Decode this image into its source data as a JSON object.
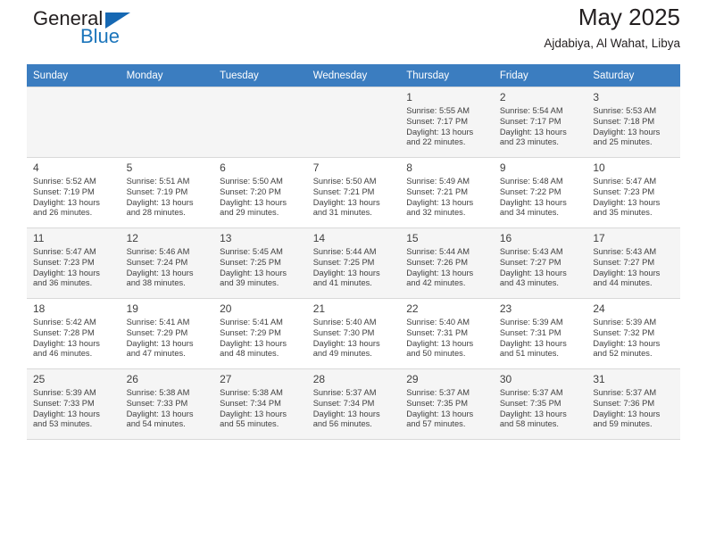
{
  "brand": {
    "name_part1": "General",
    "name_part2": "Blue",
    "triangle_color": "#1668b3",
    "blue_color": "#1b75bb"
  },
  "header": {
    "title": "May 2025",
    "subtitle": "Ajdabiya, Al Wahat, Libya"
  },
  "calendar": {
    "header_bg": "#3b7dc0",
    "weekday_headers": [
      "Sunday",
      "Monday",
      "Tuesday",
      "Wednesday",
      "Thursday",
      "Friday",
      "Saturday"
    ],
    "weeks": [
      [
        {
          "day": "",
          "sunrise": "",
          "sunset": "",
          "daylight1": "",
          "daylight2": ""
        },
        {
          "day": "",
          "sunrise": "",
          "sunset": "",
          "daylight1": "",
          "daylight2": ""
        },
        {
          "day": "",
          "sunrise": "",
          "sunset": "",
          "daylight1": "",
          "daylight2": ""
        },
        {
          "day": "",
          "sunrise": "",
          "sunset": "",
          "daylight1": "",
          "daylight2": ""
        },
        {
          "day": "1",
          "sunrise": "Sunrise: 5:55 AM",
          "sunset": "Sunset: 7:17 PM",
          "daylight1": "Daylight: 13 hours",
          "daylight2": "and 22 minutes."
        },
        {
          "day": "2",
          "sunrise": "Sunrise: 5:54 AM",
          "sunset": "Sunset: 7:17 PM",
          "daylight1": "Daylight: 13 hours",
          "daylight2": "and 23 minutes."
        },
        {
          "day": "3",
          "sunrise": "Sunrise: 5:53 AM",
          "sunset": "Sunset: 7:18 PM",
          "daylight1": "Daylight: 13 hours",
          "daylight2": "and 25 minutes."
        }
      ],
      [
        {
          "day": "4",
          "sunrise": "Sunrise: 5:52 AM",
          "sunset": "Sunset: 7:19 PM",
          "daylight1": "Daylight: 13 hours",
          "daylight2": "and 26 minutes."
        },
        {
          "day": "5",
          "sunrise": "Sunrise: 5:51 AM",
          "sunset": "Sunset: 7:19 PM",
          "daylight1": "Daylight: 13 hours",
          "daylight2": "and 28 minutes."
        },
        {
          "day": "6",
          "sunrise": "Sunrise: 5:50 AM",
          "sunset": "Sunset: 7:20 PM",
          "daylight1": "Daylight: 13 hours",
          "daylight2": "and 29 minutes."
        },
        {
          "day": "7",
          "sunrise": "Sunrise: 5:50 AM",
          "sunset": "Sunset: 7:21 PM",
          "daylight1": "Daylight: 13 hours",
          "daylight2": "and 31 minutes."
        },
        {
          "day": "8",
          "sunrise": "Sunrise: 5:49 AM",
          "sunset": "Sunset: 7:21 PM",
          "daylight1": "Daylight: 13 hours",
          "daylight2": "and 32 minutes."
        },
        {
          "day": "9",
          "sunrise": "Sunrise: 5:48 AM",
          "sunset": "Sunset: 7:22 PM",
          "daylight1": "Daylight: 13 hours",
          "daylight2": "and 34 minutes."
        },
        {
          "day": "10",
          "sunrise": "Sunrise: 5:47 AM",
          "sunset": "Sunset: 7:23 PM",
          "daylight1": "Daylight: 13 hours",
          "daylight2": "and 35 minutes."
        }
      ],
      [
        {
          "day": "11",
          "sunrise": "Sunrise: 5:47 AM",
          "sunset": "Sunset: 7:23 PM",
          "daylight1": "Daylight: 13 hours",
          "daylight2": "and 36 minutes."
        },
        {
          "day": "12",
          "sunrise": "Sunrise: 5:46 AM",
          "sunset": "Sunset: 7:24 PM",
          "daylight1": "Daylight: 13 hours",
          "daylight2": "and 38 minutes."
        },
        {
          "day": "13",
          "sunrise": "Sunrise: 5:45 AM",
          "sunset": "Sunset: 7:25 PM",
          "daylight1": "Daylight: 13 hours",
          "daylight2": "and 39 minutes."
        },
        {
          "day": "14",
          "sunrise": "Sunrise: 5:44 AM",
          "sunset": "Sunset: 7:25 PM",
          "daylight1": "Daylight: 13 hours",
          "daylight2": "and 41 minutes."
        },
        {
          "day": "15",
          "sunrise": "Sunrise: 5:44 AM",
          "sunset": "Sunset: 7:26 PM",
          "daylight1": "Daylight: 13 hours",
          "daylight2": "and 42 minutes."
        },
        {
          "day": "16",
          "sunrise": "Sunrise: 5:43 AM",
          "sunset": "Sunset: 7:27 PM",
          "daylight1": "Daylight: 13 hours",
          "daylight2": "and 43 minutes."
        },
        {
          "day": "17",
          "sunrise": "Sunrise: 5:43 AM",
          "sunset": "Sunset: 7:27 PM",
          "daylight1": "Daylight: 13 hours",
          "daylight2": "and 44 minutes."
        }
      ],
      [
        {
          "day": "18",
          "sunrise": "Sunrise: 5:42 AM",
          "sunset": "Sunset: 7:28 PM",
          "daylight1": "Daylight: 13 hours",
          "daylight2": "and 46 minutes."
        },
        {
          "day": "19",
          "sunrise": "Sunrise: 5:41 AM",
          "sunset": "Sunset: 7:29 PM",
          "daylight1": "Daylight: 13 hours",
          "daylight2": "and 47 minutes."
        },
        {
          "day": "20",
          "sunrise": "Sunrise: 5:41 AM",
          "sunset": "Sunset: 7:29 PM",
          "daylight1": "Daylight: 13 hours",
          "daylight2": "and 48 minutes."
        },
        {
          "day": "21",
          "sunrise": "Sunrise: 5:40 AM",
          "sunset": "Sunset: 7:30 PM",
          "daylight1": "Daylight: 13 hours",
          "daylight2": "and 49 minutes."
        },
        {
          "day": "22",
          "sunrise": "Sunrise: 5:40 AM",
          "sunset": "Sunset: 7:31 PM",
          "daylight1": "Daylight: 13 hours",
          "daylight2": "and 50 minutes."
        },
        {
          "day": "23",
          "sunrise": "Sunrise: 5:39 AM",
          "sunset": "Sunset: 7:31 PM",
          "daylight1": "Daylight: 13 hours",
          "daylight2": "and 51 minutes."
        },
        {
          "day": "24",
          "sunrise": "Sunrise: 5:39 AM",
          "sunset": "Sunset: 7:32 PM",
          "daylight1": "Daylight: 13 hours",
          "daylight2": "and 52 minutes."
        }
      ],
      [
        {
          "day": "25",
          "sunrise": "Sunrise: 5:39 AM",
          "sunset": "Sunset: 7:33 PM",
          "daylight1": "Daylight: 13 hours",
          "daylight2": "and 53 minutes."
        },
        {
          "day": "26",
          "sunrise": "Sunrise: 5:38 AM",
          "sunset": "Sunset: 7:33 PM",
          "daylight1": "Daylight: 13 hours",
          "daylight2": "and 54 minutes."
        },
        {
          "day": "27",
          "sunrise": "Sunrise: 5:38 AM",
          "sunset": "Sunset: 7:34 PM",
          "daylight1": "Daylight: 13 hours",
          "daylight2": "and 55 minutes."
        },
        {
          "day": "28",
          "sunrise": "Sunrise: 5:37 AM",
          "sunset": "Sunset: 7:34 PM",
          "daylight1": "Daylight: 13 hours",
          "daylight2": "and 56 minutes."
        },
        {
          "day": "29",
          "sunrise": "Sunrise: 5:37 AM",
          "sunset": "Sunset: 7:35 PM",
          "daylight1": "Daylight: 13 hours",
          "daylight2": "and 57 minutes."
        },
        {
          "day": "30",
          "sunrise": "Sunrise: 5:37 AM",
          "sunset": "Sunset: 7:35 PM",
          "daylight1": "Daylight: 13 hours",
          "daylight2": "and 58 minutes."
        },
        {
          "day": "31",
          "sunrise": "Sunrise: 5:37 AM",
          "sunset": "Sunset: 7:36 PM",
          "daylight1": "Daylight: 13 hours",
          "daylight2": "and 59 minutes."
        }
      ]
    ]
  }
}
